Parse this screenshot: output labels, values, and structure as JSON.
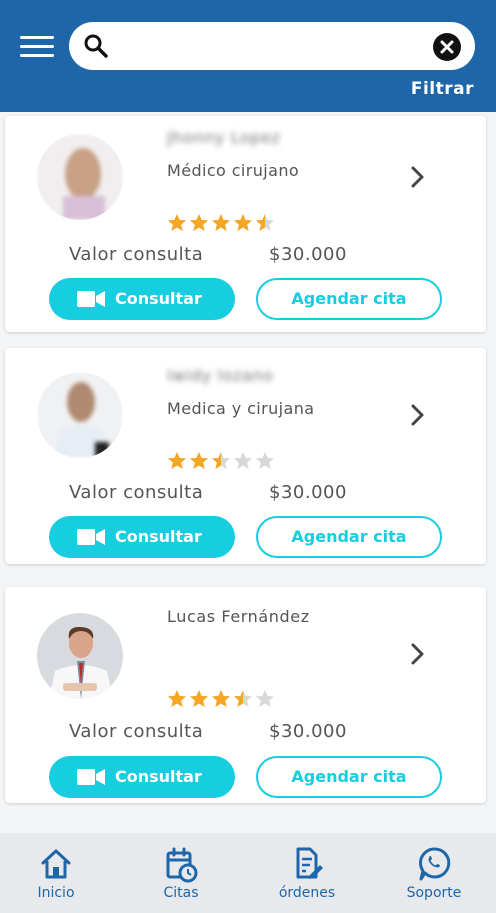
{
  "header": {
    "menu_icon": "hamburger-menu-icon",
    "search": {
      "value": "",
      "placeholder": ""
    },
    "filter_label": "Filtrar"
  },
  "doctors": [
    {
      "name": "Jhonny Lopez",
      "specialty": "Médico cirujano",
      "rating": 4.5,
      "price_label": "Valor consulta",
      "price": "$30.000",
      "consult_label": "Consultar",
      "schedule_label": "Agendar cita"
    },
    {
      "name": "Iwidy lozano",
      "specialty": "Medica y cirujana",
      "rating": 2.5,
      "price_label": "Valor consulta",
      "price": "$30.000",
      "consult_label": "Consultar",
      "schedule_label": "Agendar cita"
    },
    {
      "name": "Lucas Fernández",
      "specialty": "",
      "rating": 3.5,
      "price_label": "Valor consulta",
      "price": "$30.000",
      "consult_label": "Consultar",
      "schedule_label": "Agendar cita"
    }
  ],
  "bottom_nav": [
    {
      "label": "Inicio",
      "icon": "home-icon"
    },
    {
      "label": "Citas",
      "icon": "calendar-clock-icon"
    },
    {
      "label": "órdenes",
      "icon": "document-edit-icon"
    },
    {
      "label": "Soporte",
      "icon": "whatsapp-icon"
    }
  ],
  "colors": {
    "header": "#1f66a8",
    "accent": "#17cde0",
    "star": "#f5a623",
    "star_empty": "#d8d8d8",
    "nav_text": "#1f66a8"
  }
}
